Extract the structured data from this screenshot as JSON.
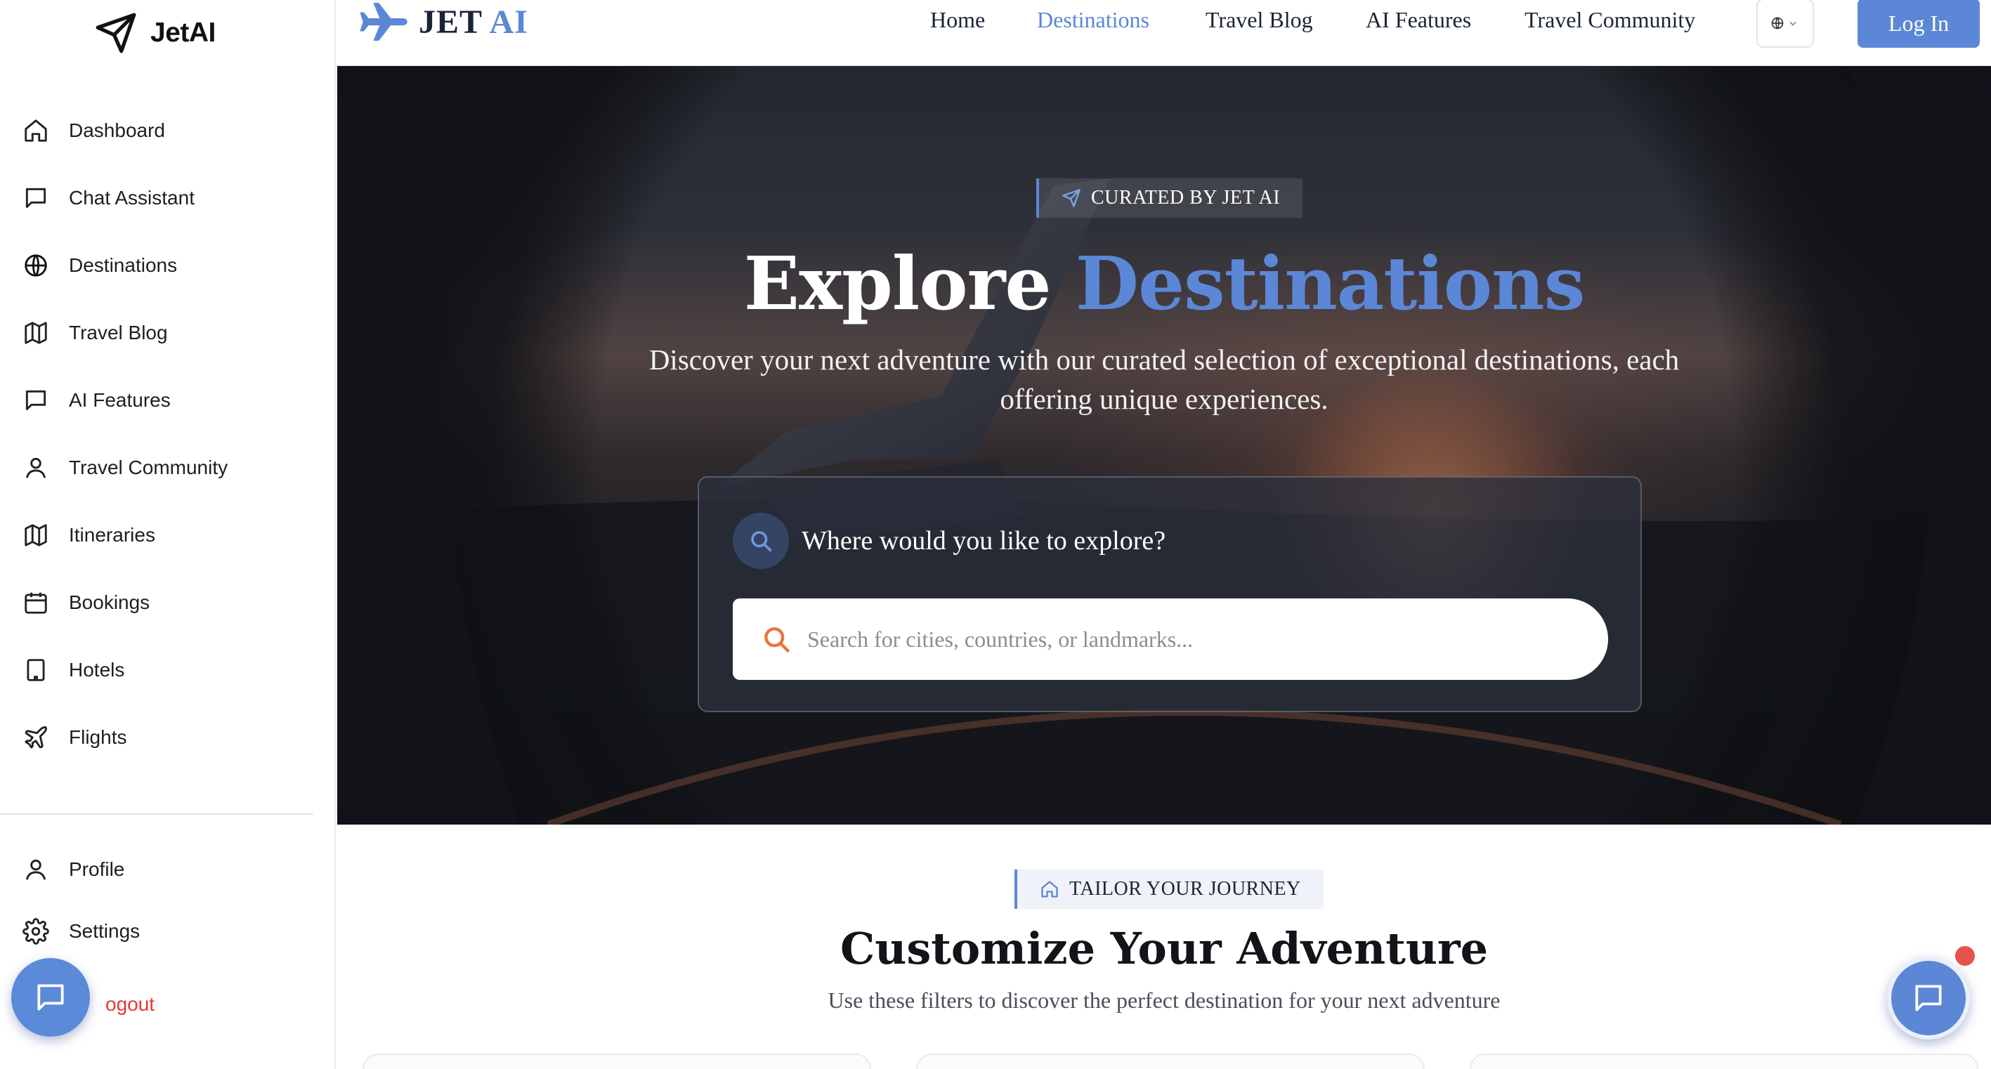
{
  "app": {
    "name": "JetAI"
  },
  "sidebar": {
    "items": [
      {
        "label": "Dashboard",
        "icon": "home-icon"
      },
      {
        "label": "Chat Assistant",
        "icon": "chat-icon"
      },
      {
        "label": "Destinations",
        "icon": "globe-icon"
      },
      {
        "label": "Travel Blog",
        "icon": "map-icon"
      },
      {
        "label": "AI Features",
        "icon": "message-icon"
      },
      {
        "label": "Travel Community",
        "icon": "user-icon"
      },
      {
        "label": "Itineraries",
        "icon": "map-icon"
      },
      {
        "label": "Bookings",
        "icon": "calendar-icon"
      },
      {
        "label": "Hotels",
        "icon": "building-icon"
      },
      {
        "label": "Flights",
        "icon": "plane-icon"
      }
    ],
    "bottom": [
      {
        "label": "Profile",
        "icon": "user-icon"
      },
      {
        "label": "Settings",
        "icon": "gear-icon"
      },
      {
        "label": "ogout",
        "icon": "logout-icon"
      }
    ]
  },
  "header": {
    "logo_jet": "JET",
    "logo_ai": "AI",
    "nav": [
      "Home",
      "Destinations",
      "Travel Blog",
      "AI Features",
      "Travel Community"
    ],
    "active_nav": "Destinations",
    "login_label": "Log In"
  },
  "hero": {
    "tag": "CURATED BY JET AI",
    "title_plain": "Explore",
    "title_accent": "Destinations",
    "subtitle": "Discover your next adventure with our curated selection of exceptional destinations, each offering unique experiences.",
    "search_heading": "Where would you like to explore?",
    "search_placeholder": "Search for cities, countries, or landmarks..."
  },
  "customize": {
    "tag": "TAILOR YOUR JOURNEY",
    "title": "Customize Your Adventure",
    "subtitle": "Use these filters to discover the perfect destination for your next adventure"
  },
  "colors": {
    "accent": "#5b87d6",
    "logout": "#e53935",
    "notification": "#e5534b"
  }
}
